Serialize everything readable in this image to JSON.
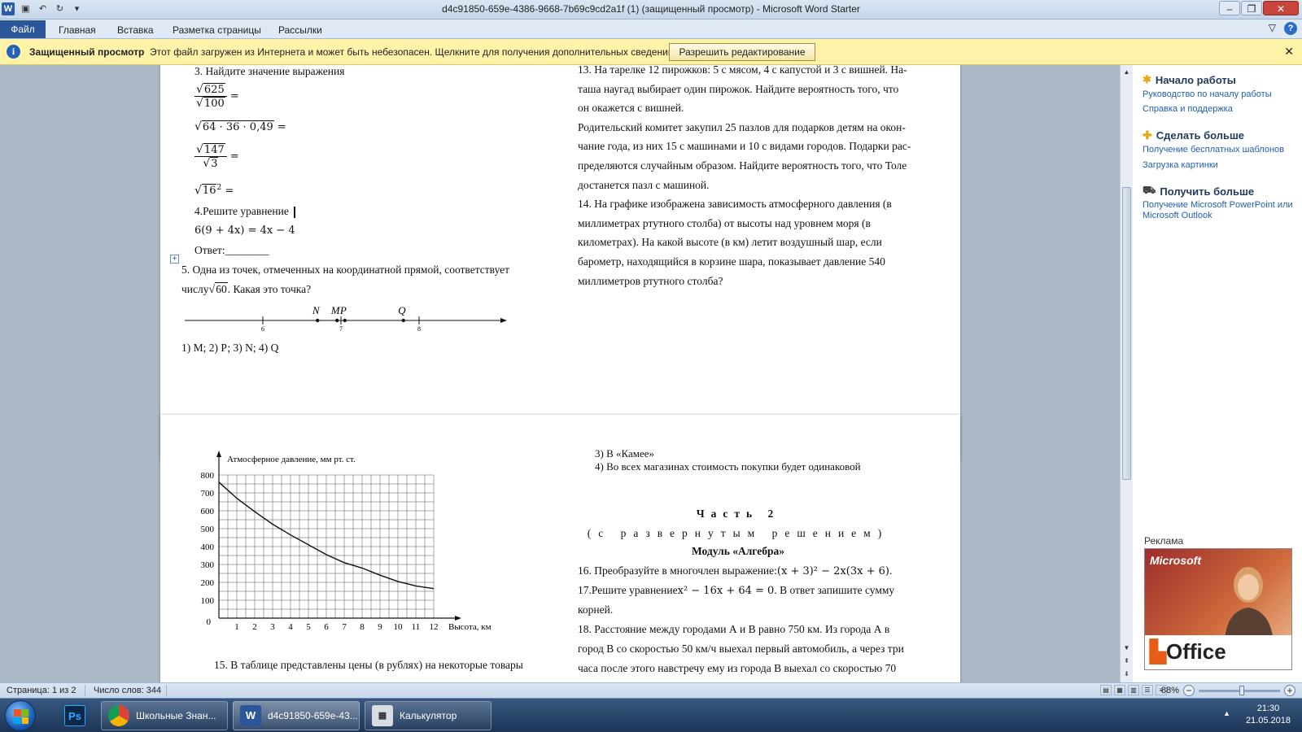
{
  "window": {
    "title": "d4c91850-659e-4386-9668-7b69c9cd2a1f (1) (защищенный просмотр)  -  Microsoft Word Starter"
  },
  "ribbon": {
    "tabs": [
      "Файл",
      "Главная",
      "Вставка",
      "Разметка страницы",
      "Рассылки"
    ]
  },
  "protected": {
    "title": "Защищенный просмотр",
    "message": "Этот файл загружен из Интернета и может быть небезопасен. Щелкните для получения дополнительных сведений.",
    "button": "Разрешить редактирование"
  },
  "page1": {
    "left": {
      "task3": "3. Найдите значение выражения",
      "e1_num": "625",
      "e1_den": "100",
      "eq": "=",
      "e2": "64 · 36 · 0,49",
      "e3_num": "147",
      "e3_den": "3",
      "e4": "16",
      "e4_exp": "2",
      "task4": "4.Решите уравнение",
      "equation": "6(9 + 4x) = 4x − 4",
      "answer": "Ответ:________",
      "task5_l1": "5. Одна из точек, отмеченных на координатной прямой, соответствует",
      "task5_l2a": "числу",
      "task5_root": "60",
      "task5_l2b": ". Какая это точка?",
      "points": [
        {
          "label": "N",
          "value": 6.7
        },
        {
          "label": "M",
          "value": 6.95
        },
        {
          "label": "P",
          "value": 7.05
        },
        {
          "label": "Q",
          "value": 7.8
        }
      ],
      "ticks": [
        {
          "label": "6",
          "value": 6
        },
        {
          "label": "7",
          "value": 7
        },
        {
          "label": "8",
          "value": 8
        }
      ],
      "options": "1) М;    2) Р;     3) N;     4) Q"
    },
    "right": [
      "13. На тарелке 12 пирожков: 5 с мясом, 4 с капустой и 3 с вишней. На-",
      "таша наугад выбирает один пирожок. Найдите вероятность того, что",
      "он окажется с вишней.",
      "Родительский комитет закупил 25 пазлов для подарков детям на окон-",
      "чание года, из них 15 с машинами и 10 с видами городов. Подарки рас-",
      "пределяются случайным образом. Найдите вероятность того, что Толе",
      "достанется пазл с машиной.",
      "14. На графике изображена зависимость атмосферного давления (в",
      "миллиметрах ртутного столба) от высоты над уровнем моря (в",
      "километрах). На какой высоте (в км) летит воздушный шар, если",
      "барометр, находящийся в корзине шара, показывает давление 540",
      "миллиметров ртутного столба?"
    ]
  },
  "page2": {
    "right": {
      "opt3": "3) В «Камее»",
      "opt4": "4) Во всех магазинах стоимость покупки будет одинаковой",
      "part": "Часть 2",
      "sub": "(с развернутым решением)",
      "module": "Модуль «Алгебра»",
      "t16a": "16. Преобразуйте в многочлен выражение:",
      "t16m": "(x + 3)² − 2x(3x + 6)",
      "t16b": ".",
      "t17a": "17.Решите уравнение",
      "t17m": "x² − 16x + 64 = 0",
      "t17b": ". В ответ запишите сумму",
      "t17c": "корней.",
      "t18": [
        "18. Расстояние между городами А и В равно 750 км. Из города А в",
        "город В со скоростью 50 км/ч выехал первый автомобиль, а через три",
        "часа после этого навстречу ему из города В выехал со скоростью 70"
      ]
    },
    "task15": "15. В таблице представлены цены (в рублях) на некоторые товары"
  },
  "chart_data": {
    "type": "line",
    "title": "",
    "ylabel": "Атмосферное давление, мм  рт. ст.",
    "xlabel": "Высота, км",
    "x": [
      0,
      1,
      2,
      3,
      4,
      5,
      6,
      7,
      8,
      9,
      10,
      11,
      12
    ],
    "series": [
      {
        "values": [
          760,
          670,
          595,
          525,
          465,
          410,
          355,
          310,
          280,
          240,
          205,
          180,
          165
        ]
      }
    ],
    "xticks": [
      "1",
      "2",
      "3",
      "4",
      "5",
      "6",
      "7",
      "8",
      "9",
      "10",
      "11",
      "12"
    ],
    "yticks": [
      "100",
      "200",
      "300",
      "400",
      "500",
      "600",
      "700",
      "800"
    ],
    "origin": "0",
    "xlim": [
      0,
      12
    ],
    "ylim": [
      0,
      800
    ],
    "grid": true
  },
  "taskpane": {
    "h1": "Начало работы",
    "l1": "Руководство по началу работы",
    "l2": "Справка и поддержка",
    "h2": "Сделать больше",
    "l3": "Получение бесплатных шаблонов",
    "l4": "Загрузка картинки",
    "h3": "Получить больше",
    "l5": "Получение Microsoft PowerPoint или Microsoft Outlook",
    "ad_label": "Реклама",
    "ad_brand": "Microsoft",
    "ad_office": "Office"
  },
  "status": {
    "page": "Страница: 1 из 2",
    "words": "Число слов: 344",
    "zoom": "88%"
  },
  "taskbar": {
    "items": [
      {
        "label": "Ps"
      },
      {
        "label": "Школьные Знан..."
      },
      {
        "label": "d4c91850-659e-43..."
      },
      {
        "label": "Калькулятор"
      }
    ],
    "time": "21:30",
    "date": "21.05.2018"
  }
}
